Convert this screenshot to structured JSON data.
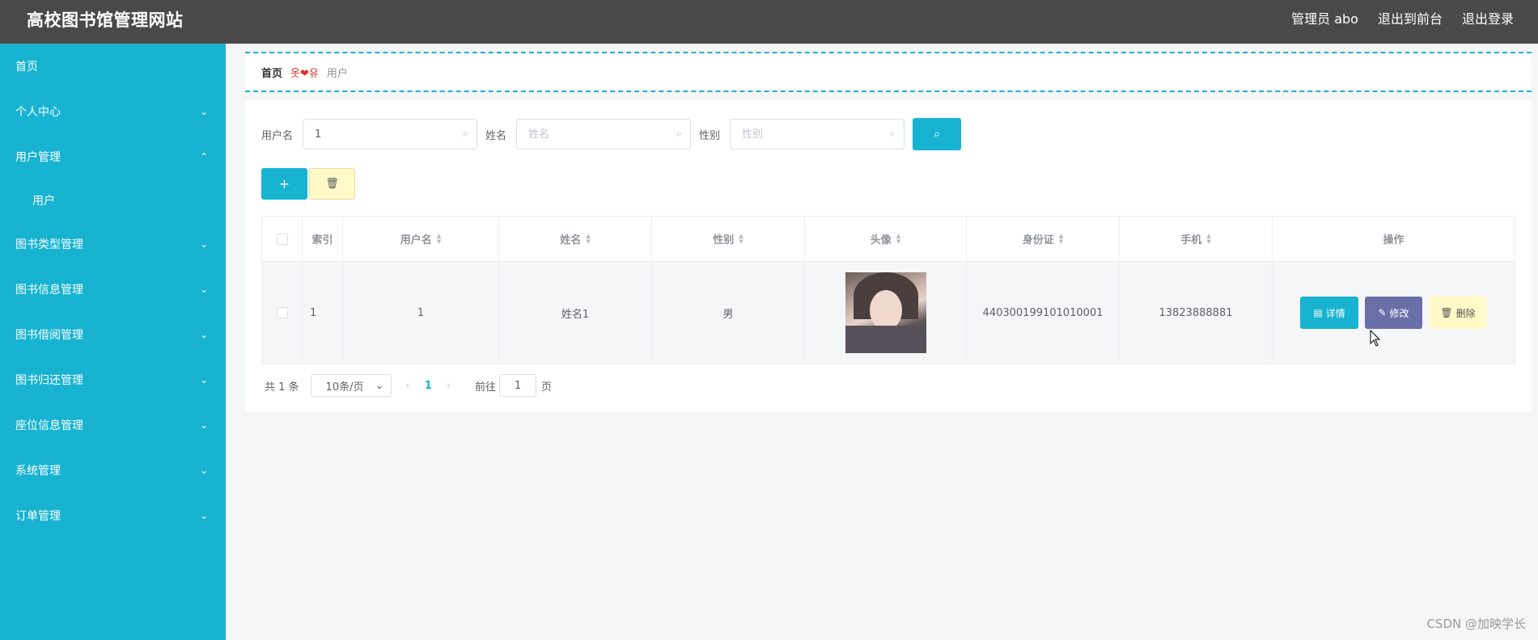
{
  "header": {
    "title": "高校图书馆管理网站",
    "admin_label": "管理员 abo",
    "to_front": "退出到前台",
    "logout": "退出登录"
  },
  "sidebar": {
    "items": [
      {
        "label": "首页",
        "chevron": ""
      },
      {
        "label": "个人中心",
        "chevron": "⌄"
      },
      {
        "label": "用户管理",
        "chevron": "⌃"
      },
      {
        "label": "图书类型管理",
        "chevron": "⌄"
      },
      {
        "label": "图书信息管理",
        "chevron": "⌄"
      },
      {
        "label": "图书借阅管理",
        "chevron": "⌄"
      },
      {
        "label": "图书归还管理",
        "chevron": "⌄"
      },
      {
        "label": "座位信息管理",
        "chevron": "⌄"
      },
      {
        "label": "系统管理",
        "chevron": "⌄"
      },
      {
        "label": "订单管理",
        "chevron": "⌄"
      }
    ],
    "sub_user": "用户"
  },
  "breadcrumb": {
    "home": "首页",
    "separator": "옷❤유",
    "current": "用户"
  },
  "search": {
    "username_label": "用户名",
    "username_value": "1",
    "name_label": "姓名",
    "name_placeholder": "姓名",
    "gender_label": "性别",
    "gender_placeholder": "性别",
    "search_icon": "search-icon"
  },
  "actions": {
    "add_icon": "+",
    "delete_icon": "🗑"
  },
  "table": {
    "headers": [
      "索引",
      "用户名",
      "姓名",
      "性别",
      "头像",
      "身份证",
      "手机",
      "操作"
    ],
    "rows": [
      {
        "index": "1",
        "username": "1",
        "name": "姓名1",
        "gender": "男",
        "idcard": "440300199101010001",
        "phone": "13823888881"
      }
    ],
    "ops": {
      "detail": "详情",
      "edit": "修改",
      "delete": "删除"
    }
  },
  "pager": {
    "total": "共 1 条",
    "page_size": "10条/页",
    "current_page": "1",
    "goto_label": "前往",
    "goto_value": "1",
    "page_suffix": "页"
  },
  "watermark": "CSDN @加映学长",
  "colors": {
    "accent": "#17b3d1",
    "topbar": "#494949",
    "edit": "#6a6fa8",
    "warn": "#fffac8"
  }
}
